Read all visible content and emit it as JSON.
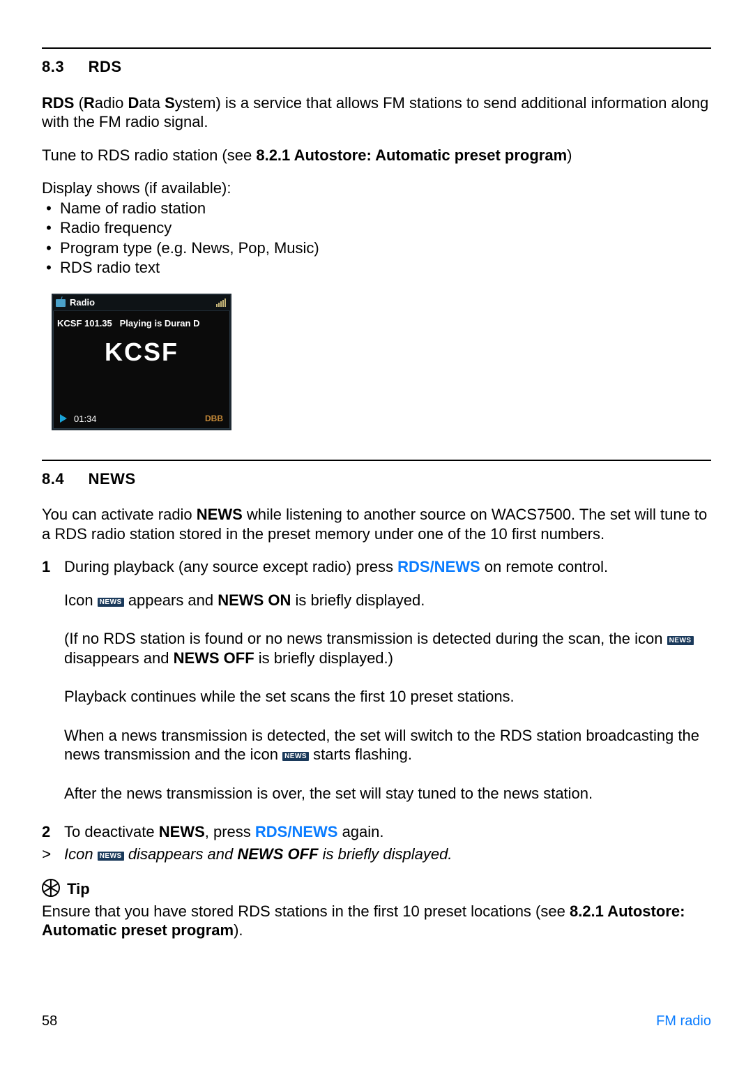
{
  "section83": {
    "num": "8.3",
    "title": "RDS",
    "intro_b1": "RDS",
    "intro_paren_open": " (",
    "intro_b_R": "R",
    "intro_adio": "adio ",
    "intro_b_D": "D",
    "intro_ata": "ata ",
    "intro_b_S": "S",
    "intro_rest": "ystem) is a service that allows FM stations to send additional information along with the FM radio signal.",
    "tune_pre": "Tune to RDS radio station (see ",
    "tune_bold": "8.2.1 Autostore:  Automatic preset program",
    "tune_post": ")",
    "display_intro": "Display shows (if available):",
    "bullets": [
      "Name of radio station",
      "Radio frequency",
      "Program type (e.g. News, Pop, Music)",
      "RDS radio text"
    ]
  },
  "device": {
    "top_label": "Radio",
    "sub_left": "KCSF 101.35",
    "sub_right": "Playing is Duran D",
    "main": "KCSF",
    "time": "01:34",
    "dbb": "DBB"
  },
  "section84": {
    "num": "8.4",
    "title": "NEWS",
    "intro_pre": "You can activate radio ",
    "intro_bold": "NEWS",
    "intro_post": " while listening to another source on WACS7500. The set will tune to a RDS radio station stored in the preset memory under one of the 10 first numbers.",
    "step1_n": "1",
    "step1_pre": "During playback (any source except radio) press ",
    "step1_btn": "RDS/NEWS",
    "step1_post": " on remote control.",
    "icon_line_pre": "Icon ",
    "icon_badge": "NEWS",
    "icon_line_mid": " appears and ",
    "icon_line_bold": "NEWS ON",
    "icon_line_post": " is briefly displayed.",
    "paren_pre": "(If no RDS station is found or no news transmission is detected during the scan, the icon ",
    "paren_mid": " disappears and ",
    "paren_bold": "NEWS OFF",
    "paren_post": " is briefly displayed.)",
    "p_scan": "Playback continues while the set scans the first 10 preset stations.",
    "p_detect_pre": "When a news transmission is detected, the set will switch to the RDS station broadcasting the news transmission and the icon ",
    "p_detect_post": " starts flashing.",
    "p_after": "After the news transmission is over, the set will stay tuned to the news station.",
    "step2_n": "2",
    "step2_pre": "To deactivate ",
    "step2_bold": "NEWS",
    "step2_mid": ", press ",
    "step2_btn": "RDS/NEWS",
    "step2_post": " again.",
    "gt_sym": ">",
    "gt_pre": "Icon ",
    "gt_mid": " disappears and ",
    "gt_bold": "NEWS OFF",
    "gt_post": " is briefly displayed."
  },
  "tip": {
    "heading": "Tip",
    "body_pre": "Ensure that you have stored RDS stations in the first 10 preset locations (see ",
    "body_bold": "8.2.1 Autostore: Automatic preset program",
    "body_post": ")."
  },
  "footer": {
    "page": "58",
    "section": "FM radio"
  }
}
